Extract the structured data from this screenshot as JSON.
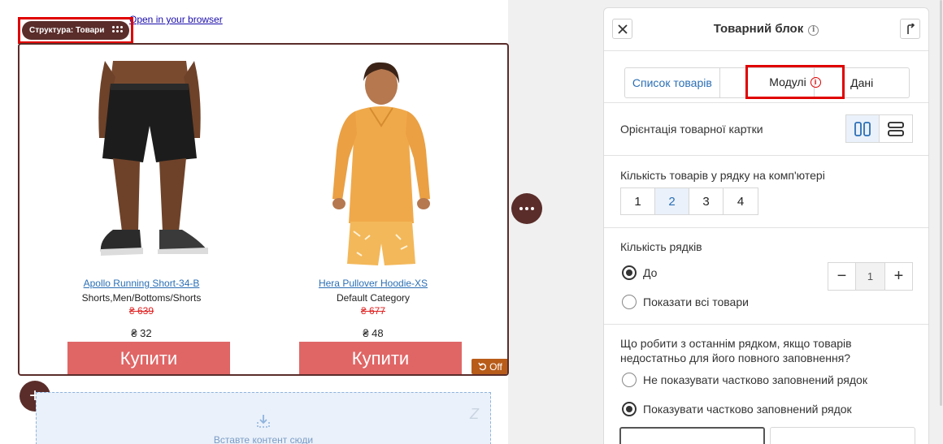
{
  "canvas": {
    "browser_link": "Open in your browser",
    "structure_badge": "Структура: Товари",
    "products": [
      {
        "name": "Apollo Running Short-34-B",
        "category": "Shorts,Men/Bottoms/Shorts",
        "old_price": "₴ 639",
        "price": "₴ 32",
        "buy_label": "Купити"
      },
      {
        "name": "Hera Pullover Hoodie-XS",
        "category": "Default Category",
        "old_price": "₴ 677",
        "price": "₴ 48",
        "buy_label": "Купити"
      }
    ],
    "off_badge": "Off",
    "drop_zone_text": "Вставте контент сюди",
    "add_label": "+"
  },
  "panel": {
    "title": "Товарний блок",
    "tabs": [
      {
        "label": "Список товарів"
      },
      {
        "label": "Модулі"
      },
      {
        "label": "Дані"
      }
    ],
    "orientation_label": "Орієнтація товарної картки",
    "per_row_label": "Кількість товарів у рядку на комп'ютері",
    "per_row_options": [
      "1",
      "2",
      "3",
      "4"
    ],
    "per_row_selected": "2",
    "rows_label": "Кількість рядків",
    "rows_option_up_to": "До",
    "rows_option_all": "Показати всі товари",
    "rows_value": "1",
    "last_row_question": "Що робити з останнім рядком, якщо товарів недостатньо для його повного заповнення?",
    "last_row_option_hide": "Не показувати частково заповнений рядок",
    "last_row_option_show": "Показувати частково заповнений рядок"
  },
  "colors": {
    "brand_dark": "#5a2d2a",
    "buy_button": "#e06666",
    "link": "#2b6fb5",
    "highlight": "#e00000"
  }
}
